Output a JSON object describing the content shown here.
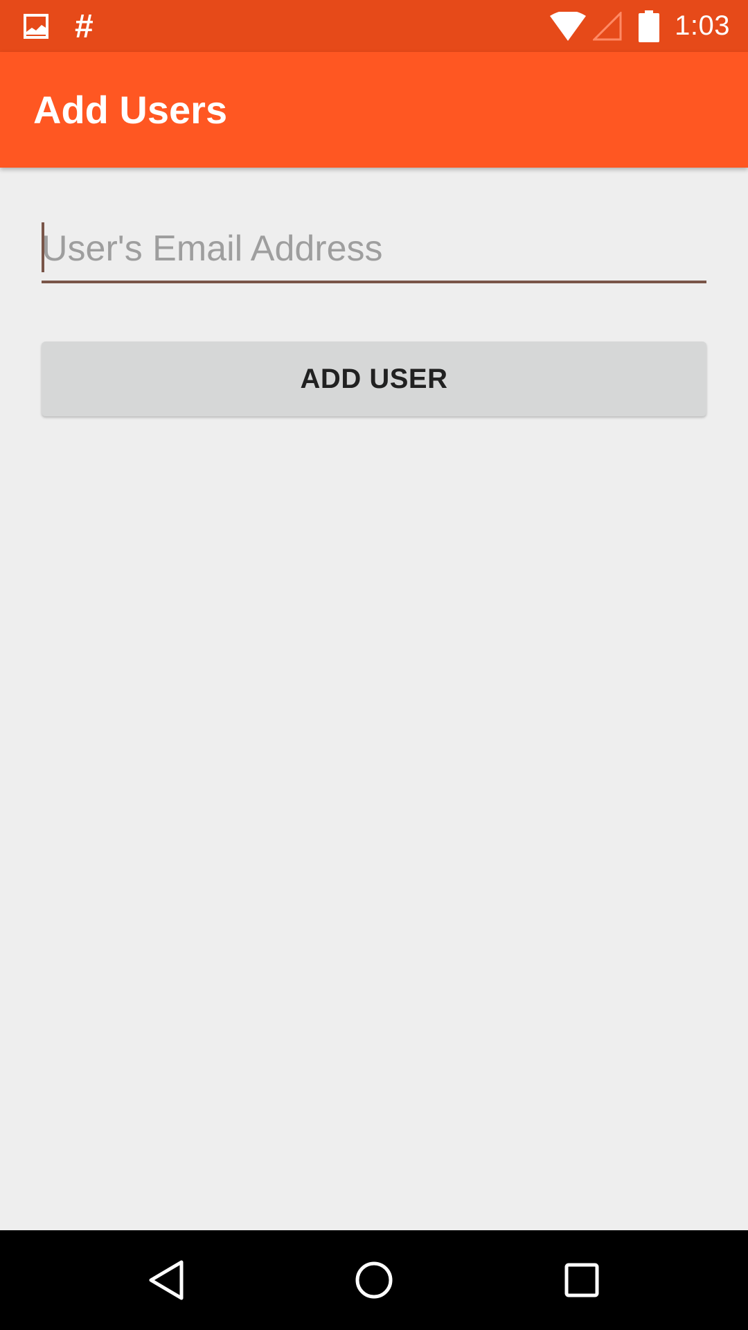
{
  "status_bar": {
    "time": "1:03",
    "notification_icons": [
      "image-icon",
      "hash-icon"
    ],
    "hash_glyph": "#",
    "system_icons": [
      "wifi-icon",
      "cell-signal-icon",
      "battery-icon"
    ]
  },
  "app_bar": {
    "title": "Add Users",
    "color": "#ff5722"
  },
  "form": {
    "email_value": "",
    "email_placeholder": "User's Email Address",
    "add_button_label": "ADD USER"
  },
  "nav_bar": {
    "buttons": [
      "back-icon",
      "home-icon",
      "recents-icon"
    ]
  },
  "colors": {
    "status_bar": "#e64a19",
    "accent_underline": "#795548",
    "background": "#eeeeee",
    "button": "#d6d7d7"
  }
}
